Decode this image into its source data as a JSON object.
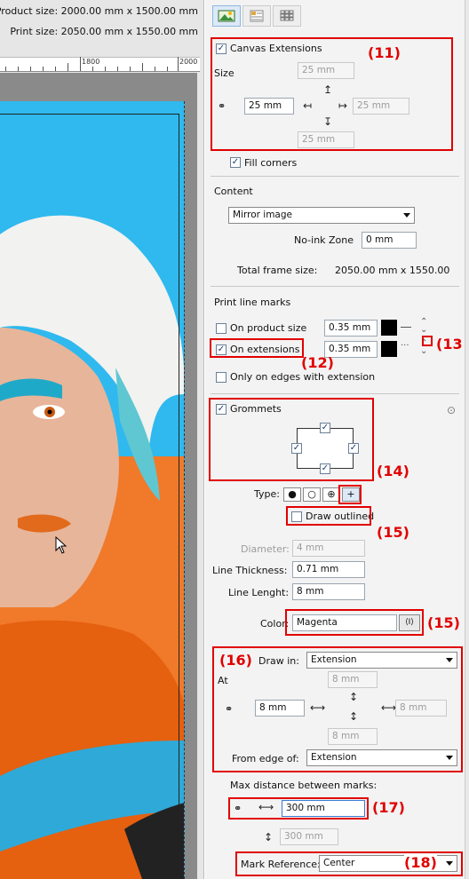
{
  "left": {
    "product_size": "Product size: 2000.00 mm x 1500.00 mm",
    "print_size": "Print size: 2050.00 mm x 1550.00 mm",
    "ruler": [
      "1800",
      "2000"
    ]
  },
  "toolbar": {
    "icons": [
      "image-icon",
      "layout-icon",
      "grid-icon"
    ]
  },
  "canvas_ext": {
    "label": "Canvas Extensions",
    "size_label": "Size",
    "top": "25 mm",
    "left": "25 mm",
    "right": "25 mm",
    "bottom": "25 mm",
    "fill_corners": "Fill corners"
  },
  "content": {
    "label": "Content",
    "mode": "Mirror image",
    "noink_label": "No-ink Zone",
    "noink": "0 mm",
    "total_label": "Total frame size:",
    "total": "2050.00 mm x 1550.00"
  },
  "marks": {
    "label": "Print line marks",
    "product": "On product size",
    "product_w": "0.35 mm",
    "ext": "On extensions",
    "ext_w": "0.35 mm",
    "edges": "Only on edges with extension",
    "color": "#000000"
  },
  "grommets": {
    "label": "Grommets",
    "type_label": "Type:",
    "types": [
      "●",
      "○",
      "⊕",
      "+"
    ],
    "draw_outlined": "Draw outlined",
    "diameter_label": "Diameter:",
    "diameter": "4 mm",
    "thick_label": "Line Thickness:",
    "thick": "0.71 mm",
    "len_label": "Line Lenght:",
    "len": "8 mm",
    "color_label": "Color:",
    "color": "Magenta",
    "picker": "⟨I⟩"
  },
  "draw": {
    "label": "Draw in:",
    "value": "Extension",
    "at": "At",
    "top": "8 mm",
    "left": "8 mm",
    "right": "8 mm",
    "bottom": "8 mm",
    "from_label": "From edge of:",
    "from": "Extension"
  },
  "max": {
    "label": "Max distance between marks:",
    "h": "300 mm",
    "v": "300 mm"
  },
  "ref": {
    "label": "Mark Reference:",
    "value": "Center"
  },
  "callouts": {
    "c11": "(11)",
    "c12": "(12)",
    "c13": "(13",
    "c14": "(14)",
    "c15a": "(15)",
    "c15b": "(15)",
    "c16": "(16)",
    "c17": "(17)",
    "c18": "(18)"
  }
}
